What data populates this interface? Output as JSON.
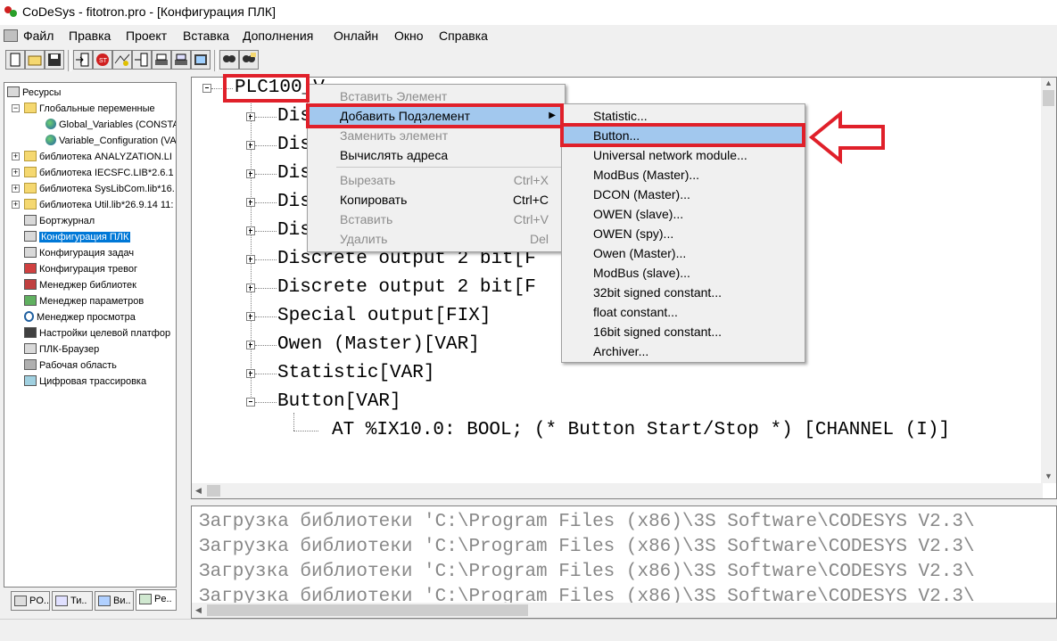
{
  "window": {
    "title": "CoDeSys - fitotron.pro - [Конфигурация ПЛК]"
  },
  "menu": [
    "Файл",
    "Правка",
    "Проект",
    "Вставка",
    "Дополнения",
    "Онлайн",
    "Окно",
    "Справка"
  ],
  "resources_tree": {
    "root": "Ресурсы",
    "items": [
      "Глобальные переменные",
      "Global_Variables (CONSTA",
      "Variable_Configuration (VAI",
      "библиотека ANALYZATION.LI",
      "библиотека IECSFC.LIB*2.6.1",
      "библиотека SysLibCom.lib*16.",
      "библиотека Util.lib*26.9.14 11:",
      "Бортжурнал",
      "Конфигурация ПЛК",
      "Конфигурация задач",
      "Конфигурация тревог",
      "Менеджер библиотек",
      "Менеджер параметров",
      "Менеджер просмотра",
      "Настройки целевой платфор",
      "ПЛК-Браузер",
      "Рабочая область",
      "Цифровая трассировка"
    ]
  },
  "left_tabs": [
    "PO..",
    "Ти..",
    "Ви..",
    "Pe.."
  ],
  "plc_tree": {
    "root": "PLC100_V",
    "nodes": [
      "Dis",
      "Dis",
      "Dis",
      "Dis",
      "Dis",
      "Discrete output 2 bit[F",
      "Discrete output 2 bit[F",
      "Special output[FIX]",
      "Owen (Master)[VAR]",
      "Statistic[VAR]",
      "Button[VAR]"
    ],
    "child": "AT %IX10.0: BOOL; (* Button Start/Stop *) [CHANNEL (I)]"
  },
  "context_menu": {
    "items": [
      {
        "label": "Вставить Элемент",
        "shortcut": ""
      },
      {
        "label": "Добавить Подэлемент",
        "shortcut": ""
      },
      {
        "label": "Заменить элемент",
        "shortcut": ""
      },
      {
        "label": "Вычислять адреса",
        "shortcut": ""
      },
      {
        "label": "Вырезать",
        "shortcut": "Ctrl+X"
      },
      {
        "label": "Копировать",
        "shortcut": "Ctrl+C"
      },
      {
        "label": "Вставить",
        "shortcut": "Ctrl+V"
      },
      {
        "label": "Удалить",
        "shortcut": "Del"
      }
    ]
  },
  "submenu": {
    "items": [
      "Statistic...",
      "Button...",
      "Universal network module...",
      "ModBus (Master)...",
      "DCON (Master)...",
      "OWEN (slave)...",
      "OWEN (spy)...",
      "Owen (Master)...",
      "ModBus (slave)...",
      "32bit signed constant...",
      "float constant...",
      "16bit signed constant...",
      "Archiver..."
    ]
  },
  "messages": [
    "Загрузка библиотеки 'C:\\Program Files (x86)\\3S Software\\CODESYS V2.3\\",
    "Загрузка библиотеки 'C:\\Program Files (x86)\\3S Software\\CODESYS V2.3\\",
    "Загрузка библиотеки 'C:\\Program Files (x86)\\3S Software\\CODESYS V2.3\\",
    "Загрузка библиотеки 'C:\\Program Files (x86)\\3S Software\\CODESYS V2.3\\"
  ],
  "colors": {
    "highlight": "#a2c8ee",
    "selection": "#0078d7",
    "annotation_red": "#e0202a"
  }
}
